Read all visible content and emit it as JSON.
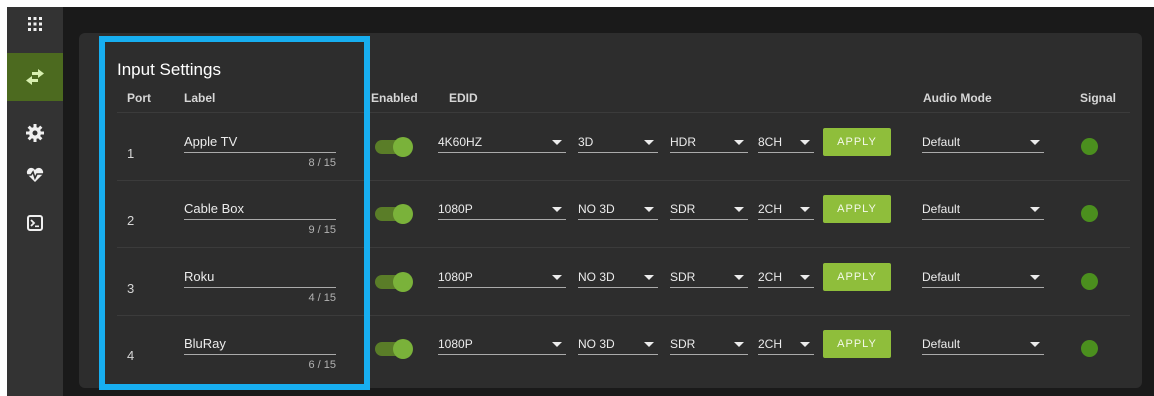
{
  "sidebar": {
    "items": [
      {
        "icon": "grid-icon",
        "active": false
      },
      {
        "icon": "swap-arrows-icon",
        "active": true
      },
      {
        "icon": "gear-icon",
        "active": false
      },
      {
        "icon": "heartbeat-icon",
        "active": false
      },
      {
        "icon": "terminal-icon",
        "active": false
      }
    ]
  },
  "panel": {
    "title": "Input Settings",
    "headers": {
      "port": "Port",
      "label": "Label",
      "enabled": "Enabled",
      "edid": "EDID",
      "audio_mode": "Audio Mode",
      "signal": "Signal"
    }
  },
  "rows": [
    {
      "port": "1",
      "label": "Apple TV",
      "count": "8 / 15",
      "enabled": true,
      "edid": "4K60HZ",
      "mode3d": "3D",
      "range": "HDR",
      "channels": "8CH",
      "apply": "APPLY",
      "audio": "Default",
      "signal_color": "#4b8f1e"
    },
    {
      "port": "2",
      "label": "Cable Box",
      "count": "9 / 15",
      "enabled": true,
      "edid": "1080P",
      "mode3d": "NO 3D",
      "range": "SDR",
      "channels": "2CH",
      "apply": "APPLY",
      "audio": "Default",
      "signal_color": "#4b8f1e"
    },
    {
      "port": "3",
      "label": "Roku",
      "count": "4 / 15",
      "enabled": true,
      "edid": "1080P",
      "mode3d": "NO 3D",
      "range": "SDR",
      "channels": "2CH",
      "apply": "APPLY",
      "audio": "Default",
      "signal_color": "#4b8f1e"
    },
    {
      "port": "4",
      "label": "BluRay",
      "count": "6 / 15",
      "enabled": true,
      "edid": "1080P",
      "mode3d": "NO 3D",
      "range": "SDR",
      "channels": "2CH",
      "apply": "APPLY",
      "audio": "Default",
      "signal_color": "#4b8f1e"
    }
  ],
  "colors": {
    "accent_green": "#8fbe3b",
    "highlight_blue": "#17aef0",
    "sidebar_active": "#4c6a1f"
  }
}
